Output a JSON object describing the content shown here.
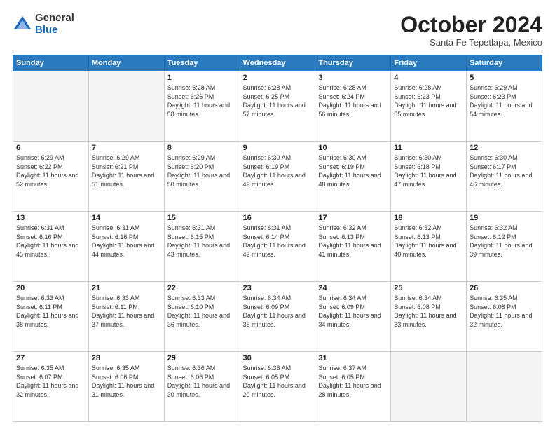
{
  "header": {
    "logo_general": "General",
    "logo_blue": "Blue",
    "month_title": "October 2024",
    "location": "Santa Fe Tepetlapa, Mexico"
  },
  "days_of_week": [
    "Sunday",
    "Monday",
    "Tuesday",
    "Wednesday",
    "Thursday",
    "Friday",
    "Saturday"
  ],
  "weeks": [
    [
      {
        "day": "",
        "empty": true
      },
      {
        "day": "",
        "empty": true
      },
      {
        "day": "1",
        "sunrise": "6:28 AM",
        "sunset": "6:26 PM",
        "daylight": "11 hours and 58 minutes."
      },
      {
        "day": "2",
        "sunrise": "6:28 AM",
        "sunset": "6:25 PM",
        "daylight": "11 hours and 57 minutes."
      },
      {
        "day": "3",
        "sunrise": "6:28 AM",
        "sunset": "6:24 PM",
        "daylight": "11 hours and 56 minutes."
      },
      {
        "day": "4",
        "sunrise": "6:28 AM",
        "sunset": "6:23 PM",
        "daylight": "11 hours and 55 minutes."
      },
      {
        "day": "5",
        "sunrise": "6:29 AM",
        "sunset": "6:23 PM",
        "daylight": "11 hours and 54 minutes."
      }
    ],
    [
      {
        "day": "6",
        "sunrise": "6:29 AM",
        "sunset": "6:22 PM",
        "daylight": "11 hours and 52 minutes."
      },
      {
        "day": "7",
        "sunrise": "6:29 AM",
        "sunset": "6:21 PM",
        "daylight": "11 hours and 51 minutes."
      },
      {
        "day": "8",
        "sunrise": "6:29 AM",
        "sunset": "6:20 PM",
        "daylight": "11 hours and 50 minutes."
      },
      {
        "day": "9",
        "sunrise": "6:30 AM",
        "sunset": "6:19 PM",
        "daylight": "11 hours and 49 minutes."
      },
      {
        "day": "10",
        "sunrise": "6:30 AM",
        "sunset": "6:19 PM",
        "daylight": "11 hours and 48 minutes."
      },
      {
        "day": "11",
        "sunrise": "6:30 AM",
        "sunset": "6:18 PM",
        "daylight": "11 hours and 47 minutes."
      },
      {
        "day": "12",
        "sunrise": "6:30 AM",
        "sunset": "6:17 PM",
        "daylight": "11 hours and 46 minutes."
      }
    ],
    [
      {
        "day": "13",
        "sunrise": "6:31 AM",
        "sunset": "6:16 PM",
        "daylight": "11 hours and 45 minutes."
      },
      {
        "day": "14",
        "sunrise": "6:31 AM",
        "sunset": "6:16 PM",
        "daylight": "11 hours and 44 minutes."
      },
      {
        "day": "15",
        "sunrise": "6:31 AM",
        "sunset": "6:15 PM",
        "daylight": "11 hours and 43 minutes."
      },
      {
        "day": "16",
        "sunrise": "6:31 AM",
        "sunset": "6:14 PM",
        "daylight": "11 hours and 42 minutes."
      },
      {
        "day": "17",
        "sunrise": "6:32 AM",
        "sunset": "6:13 PM",
        "daylight": "11 hours and 41 minutes."
      },
      {
        "day": "18",
        "sunrise": "6:32 AM",
        "sunset": "6:13 PM",
        "daylight": "11 hours and 40 minutes."
      },
      {
        "day": "19",
        "sunrise": "6:32 AM",
        "sunset": "6:12 PM",
        "daylight": "11 hours and 39 minutes."
      }
    ],
    [
      {
        "day": "20",
        "sunrise": "6:33 AM",
        "sunset": "6:11 PM",
        "daylight": "11 hours and 38 minutes."
      },
      {
        "day": "21",
        "sunrise": "6:33 AM",
        "sunset": "6:11 PM",
        "daylight": "11 hours and 37 minutes."
      },
      {
        "day": "22",
        "sunrise": "6:33 AM",
        "sunset": "6:10 PM",
        "daylight": "11 hours and 36 minutes."
      },
      {
        "day": "23",
        "sunrise": "6:34 AM",
        "sunset": "6:09 PM",
        "daylight": "11 hours and 35 minutes."
      },
      {
        "day": "24",
        "sunrise": "6:34 AM",
        "sunset": "6:09 PM",
        "daylight": "11 hours and 34 minutes."
      },
      {
        "day": "25",
        "sunrise": "6:34 AM",
        "sunset": "6:08 PM",
        "daylight": "11 hours and 33 minutes."
      },
      {
        "day": "26",
        "sunrise": "6:35 AM",
        "sunset": "6:08 PM",
        "daylight": "11 hours and 32 minutes."
      }
    ],
    [
      {
        "day": "27",
        "sunrise": "6:35 AM",
        "sunset": "6:07 PM",
        "daylight": "11 hours and 32 minutes."
      },
      {
        "day": "28",
        "sunrise": "6:35 AM",
        "sunset": "6:06 PM",
        "daylight": "11 hours and 31 minutes."
      },
      {
        "day": "29",
        "sunrise": "6:36 AM",
        "sunset": "6:06 PM",
        "daylight": "11 hours and 30 minutes."
      },
      {
        "day": "30",
        "sunrise": "6:36 AM",
        "sunset": "6:05 PM",
        "daylight": "11 hours and 29 minutes."
      },
      {
        "day": "31",
        "sunrise": "6:37 AM",
        "sunset": "6:05 PM",
        "daylight": "11 hours and 28 minutes."
      },
      {
        "day": "",
        "empty": true
      },
      {
        "day": "",
        "empty": true
      }
    ]
  ]
}
